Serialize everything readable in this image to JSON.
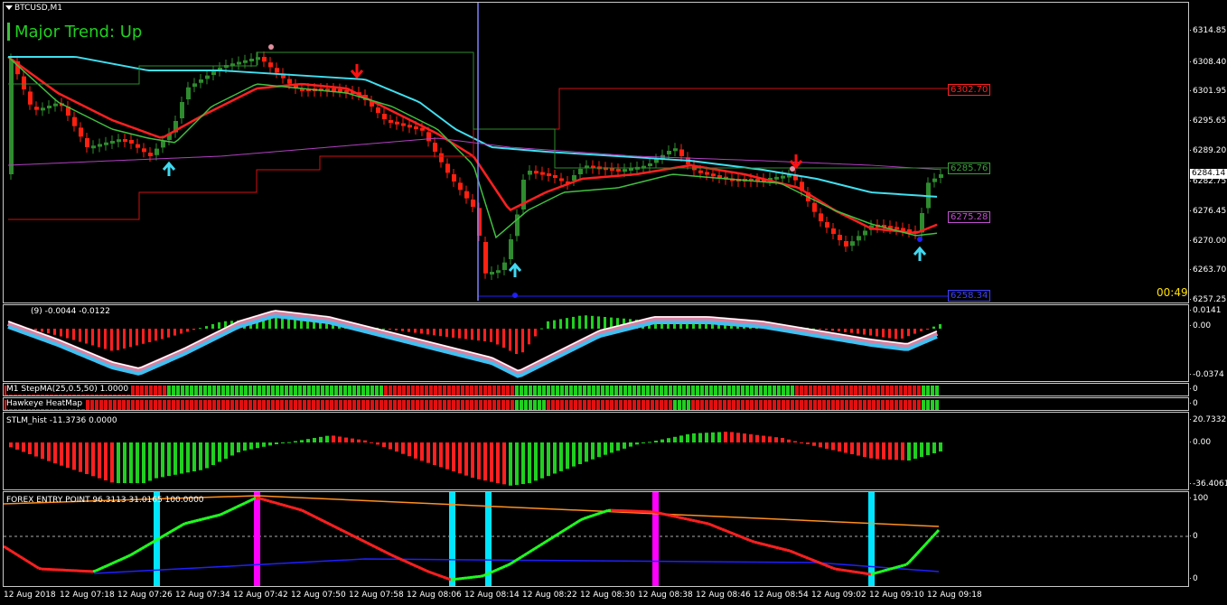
{
  "main": {
    "symbol": "BTCUSD,M1",
    "trend_label": "Major Trend: Up",
    "countdown": "00:49",
    "price_labels": [
      {
        "value": "6302.70",
        "color": "#ff2020"
      },
      {
        "value": "6285.76",
        "color": "#2e8b2e"
      },
      {
        "value": "6275.28",
        "color": "#b040c0"
      },
      {
        "value": "6258.34",
        "color": "#2020ff"
      }
    ],
    "current_price": "6284.14",
    "axis_ticks": [
      "6314.85",
      "6308.40",
      "6301.95",
      "6295.65",
      "6289.20",
      "6282.75",
      "6276.45",
      "6270.00",
      "6263.70",
      "6257.25"
    ]
  },
  "macd_pane": {
    "label": "(9) -0.0044 -0.0122",
    "axis_ticks": [
      "0.0141",
      "0.00",
      "-0.0374"
    ]
  },
  "stepma_pane": {
    "label": "M1 StepMA(25,0.5,50) 1.0000",
    "axis_value": "0"
  },
  "heatmap_pane": {
    "label": "Hawkeye HeatMap",
    "axis_value": "0"
  },
  "stlm_pane": {
    "label": "STLM_hist -11.3736 0.0000",
    "axis_ticks": [
      "20.7332",
      "0.00",
      "-36.4061"
    ]
  },
  "forex_pane": {
    "label": "FOREX ENTRY POINT 96.3113 31.0165 100.0000",
    "axis_ticks": [
      "100",
      "0",
      "0"
    ]
  },
  "time_axis": [
    "12 Aug 2018",
    "12 Aug 07:18",
    "12 Aug 07:26",
    "12 Aug 07:34",
    "12 Aug 07:42",
    "12 Aug 07:50",
    "12 Aug 07:58",
    "12 Aug 08:06",
    "12 Aug 08:14",
    "12 Aug 08:22",
    "12 Aug 08:30",
    "12 Aug 08:38",
    "12 Aug 08:46",
    "12 Aug 08:54",
    "12 Aug 09:02",
    "12 Aug 09:10",
    "12 Aug 09:18"
  ],
  "colors": {
    "bull": "#2e8b2e",
    "bear": "#ff2010",
    "cyan": "#40d8f0",
    "magenta": "#ff00ff",
    "ma_red": "#ff2020",
    "ma_green": "#40c040",
    "ma_cyan": "#40e0f0",
    "ma_purple": "#b040c0"
  }
}
